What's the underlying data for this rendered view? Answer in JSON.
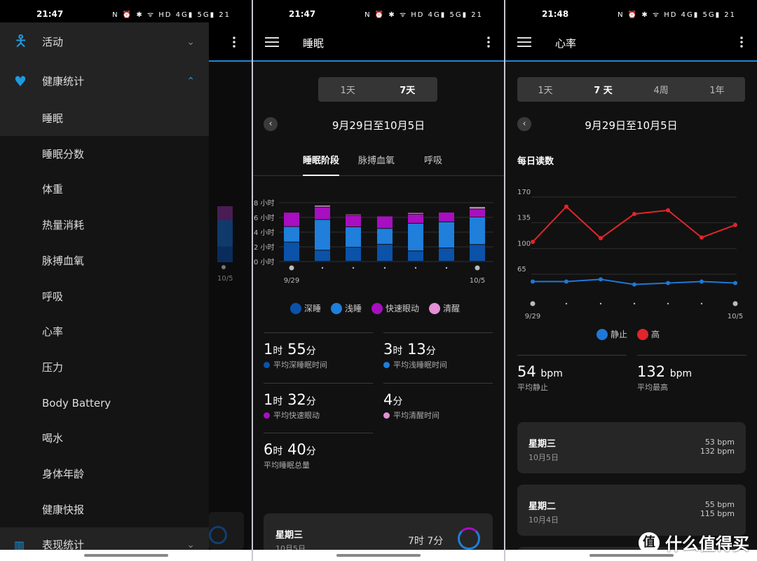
{
  "status": {
    "time1": "21:47",
    "time2": "21:47",
    "time3": "21:48",
    "icons": "N ⏰ ✱ ᯤ HD 4G▮ 5G▮ 21"
  },
  "drawer": {
    "activity": {
      "label": "活动",
      "icon": "person-icon"
    },
    "health": {
      "label": "健康统计",
      "icon": "heart-pulse-icon"
    },
    "items": [
      "睡眠",
      "睡眠分数",
      "体重",
      "热量消耗",
      "脉搏血氧",
      "呼吸",
      "心率",
      "压力",
      "Body Battery",
      "喝水",
      "身体年龄",
      "健康快报"
    ],
    "performance": {
      "label": "表现统计",
      "icon": "bar-chart-icon"
    },
    "background_date": "10/5"
  },
  "sleep": {
    "title": "睡眠",
    "ranges": [
      "1天",
      "7天"
    ],
    "selected_range": "7天",
    "date_range": "9月29日至10月5日",
    "tabs": [
      "睡眠阶段",
      "脉搏血氧",
      "呼吸"
    ],
    "active_tab": "睡眠阶段",
    "legend": [
      "深睡",
      "浅睡",
      "快速眼动",
      "清醒"
    ],
    "stats": [
      {
        "h": "1",
        "hu": "时",
        "m": "55",
        "mu": "分",
        "label": "平均深睡眠时间",
        "color": "#0b52a8"
      },
      {
        "h": "3",
        "hu": "时",
        "m": "13",
        "mu": "分",
        "label": "平均浅睡眠时间",
        "color": "#1f7fdb"
      },
      {
        "h": "1",
        "hu": "时",
        "m": "32",
        "mu": "分",
        "label": "平均快速眼动",
        "color": "#a70fc0"
      },
      {
        "h": "",
        "hu": "",
        "m": "4",
        "mu": "分",
        "label": "平均清醒时间",
        "color": "#e58fd6"
      },
      {
        "h": "6",
        "hu": "时",
        "m": "40",
        "mu": "分",
        "label": "平均睡眠总量",
        "color": ""
      }
    ],
    "card": {
      "day": "星期三",
      "date": "10月5日",
      "total": "7时 7分"
    }
  },
  "heart": {
    "title": "心率",
    "ranges": [
      "1天",
      "7 天",
      "4周",
      "1年"
    ],
    "selected_range": "7 天",
    "date_range": "9月29日至10月5日",
    "section": "每日读数",
    "legend": [
      "静止",
      "高"
    ],
    "stats": [
      {
        "value": "54",
        "unit": "bpm",
        "label": "平均静止"
      },
      {
        "value": "132",
        "unit": "bpm",
        "label": "平均最高"
      }
    ],
    "cards": [
      {
        "day": "星期三",
        "date": "10月5日",
        "rest": "53 bpm",
        "high": "132 bpm"
      },
      {
        "day": "星期二",
        "date": "10月4日",
        "rest": "55 bpm",
        "high": "115 bpm"
      }
    ]
  },
  "watermark": {
    "logo": "值",
    "text": "什么值得买"
  },
  "colors": {
    "accent": "#1e88d8",
    "deep": "#0b52a8",
    "light": "#1f7fdb",
    "rem": "#a70fc0",
    "awake": "#e58fd6",
    "hr_rest": "#1f78d6",
    "hr_high": "#e0262b"
  },
  "chart_data": [
    {
      "type": "bar",
      "stacked": true,
      "categories": [
        "9/29",
        "9/30",
        "10/1",
        "10/2",
        "10/3",
        "10/4",
        "10/5"
      ],
      "x_tick_labels": [
        "9/29",
        "10/5"
      ],
      "yticks": [
        "0 小时",
        "2 小时",
        "4 小时",
        "6 小时",
        "8 小时"
      ],
      "ylim": [
        0,
        8
      ],
      "grid": true,
      "series": [
        {
          "name": "深睡",
          "values": [
            2.6,
            1.5,
            1.9,
            2.3,
            1.4,
            1.8,
            2.27
          ]
        },
        {
          "name": "浅睡",
          "values": [
            2.1,
            4.16,
            2.77,
            2.15,
            3.75,
            3.54,
            3.73
          ]
        },
        {
          "name": "快速眼动",
          "values": [
            1.95,
            1.7,
            1.57,
            1.69,
            1.25,
            1.32,
            1.1
          ]
        },
        {
          "name": "清醒",
          "values": [
            0,
            0.24,
            0.16,
            0,
            0.2,
            0,
            0.3
          ]
        }
      ],
      "legend": "bottom"
    },
    {
      "type": "line",
      "categories": [
        "9/29",
        "9/30",
        "10/1",
        "10/2",
        "10/3",
        "10/4",
        "10/5"
      ],
      "x_tick_labels": [
        "9/29",
        "10/5"
      ],
      "yticks": [
        "65",
        "100",
        "135",
        "170"
      ],
      "ylim": [
        65,
        170
      ],
      "grid": true,
      "series": [
        {
          "name": "静止",
          "values": [
            55,
            55,
            58,
            51,
            53,
            55,
            53
          ]
        },
        {
          "name": "高",
          "values": [
            109,
            157,
            114,
            147,
            152,
            115,
            132
          ]
        }
      ],
      "legend": "bottom"
    }
  ]
}
